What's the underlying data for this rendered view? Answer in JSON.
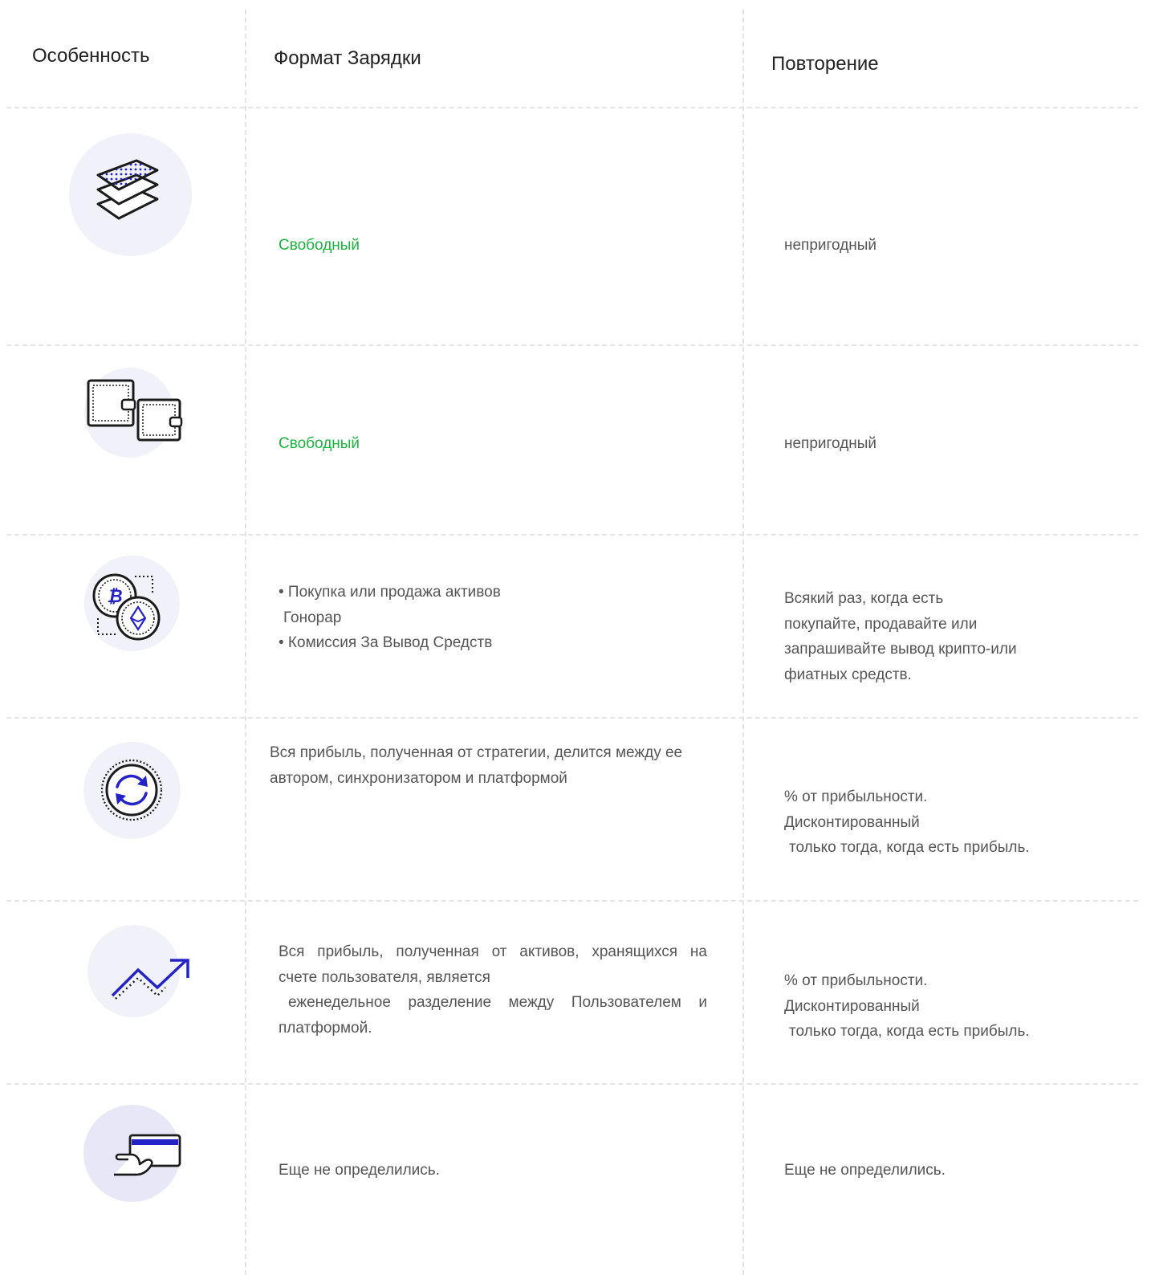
{
  "header": {
    "feature": "Особенность",
    "charge_format": "Формат Зарядки",
    "recurrence": "Повторение"
  },
  "rows": [
    {
      "icon": "layers-icon",
      "format": "Свободный",
      "recurrence": "непригодный"
    },
    {
      "icon": "wallets-icon",
      "format": "Свободный",
      "recurrence": "непригодный"
    },
    {
      "icon": "crypto-coins-icon",
      "format_lines": [
        "• Покупка или продажа активов",
        "Гонорар",
        "• Комиссия За Вывод Средств"
      ],
      "recurrence_lines": [
        "Всякий раз, когда есть",
        "покупайте, продавайте или",
        "запрашивайте вывод крипто-или",
        "фиатных средств."
      ]
    },
    {
      "icon": "sync-icon",
      "format_lines": [
        "Вся прибыль, полученная от стратегии, делится между ее",
        "автором, синхронизатором и платформой"
      ],
      "recurrence_lines": [
        "% от прибыльности.",
        "Дисконтированный",
        "только тогда, когда есть прибыль."
      ]
    },
    {
      "icon": "trend-up-icon",
      "format_lines": [
        "Вся прибыль, полученная от активов, хранящихся на",
        "счете пользователя, является",
        "еженедельное разделение между Пользователем и",
        "платформой."
      ],
      "recurrence_lines": [
        "% от прибыльности.",
        "Дисконтированный",
        "только тогда, когда есть прибыль."
      ]
    },
    {
      "icon": "card-payment-icon",
      "format": "Еще не определились.",
      "recurrence": "Еще не определились."
    }
  ],
  "colors": {
    "free_text": "#1db43f",
    "icon_accent": "#2323c8",
    "icon_stroke": "#1b1b1b",
    "icon_bg": "#f1f1fa"
  }
}
